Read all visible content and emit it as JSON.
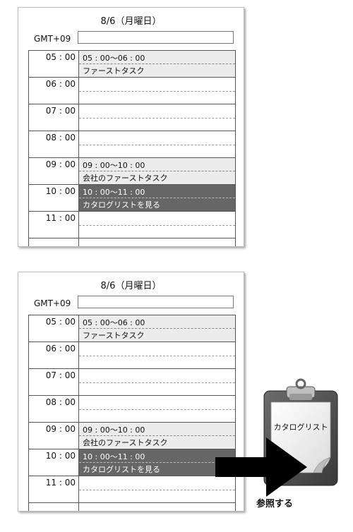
{
  "top_panel": {
    "title": "8/6（月曜日）",
    "timezone_label": "GMT+09",
    "timezone_value": "",
    "hours": [
      "05 : 00",
      "06 : 00",
      "07 : 00",
      "08 : 00",
      "09 : 00",
      "10 : 00",
      "11 : 00"
    ],
    "events": [
      {
        "time": "05 : 00〜06 : 00",
        "title": "ファーストタスク"
      },
      {
        "time": "09 : 00〜10 : 00",
        "title": "会社のファーストタスク"
      },
      {
        "time": "10 : 00〜11 : 00",
        "title": "カタログリストを見る"
      }
    ]
  },
  "bottom_panel": {
    "title": "8/6（月曜日）",
    "timezone_label": "GMT+09",
    "timezone_value": "",
    "hours": [
      "05 : 00",
      "06 : 00",
      "07 : 00",
      "08 : 00",
      "09 : 00",
      "10 : 00",
      "11 : 00"
    ],
    "events": [
      {
        "time": "05 : 00〜06 : 00",
        "title": "ファーストタスク"
      },
      {
        "time": "09 : 00〜10 : 00",
        "title": "会社のファーストタスク"
      },
      {
        "time": "10 : 00〜11 : 00",
        "title": "カタログリストを見る"
      }
    ]
  },
  "clipboard": {
    "label": "カタログリスト"
  },
  "reference": {
    "label": "参照する"
  },
  "colors": {
    "event_light": "#ececec",
    "event_dark": "#666666",
    "arrow": "#000000"
  },
  "icons": [
    "clipboard-icon",
    "arrow-right-icon"
  ]
}
